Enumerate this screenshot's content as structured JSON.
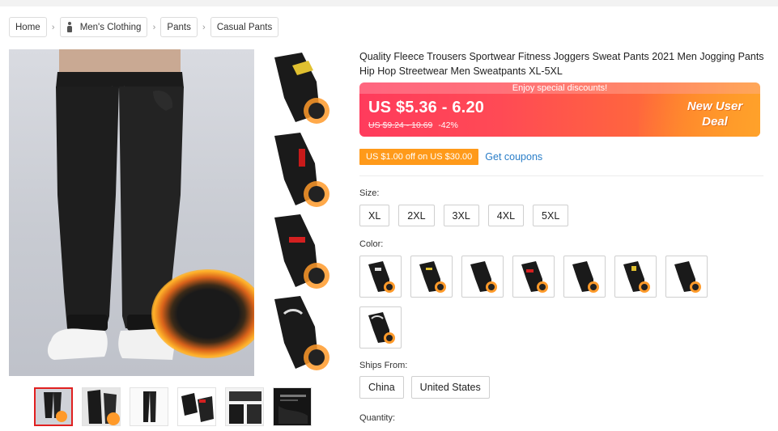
{
  "breadcrumb": {
    "items": [
      {
        "label": "Home"
      },
      {
        "label": "Men's Clothing",
        "icon": "person-icon"
      },
      {
        "label": "Pants"
      },
      {
        "label": "Casual Pants"
      }
    ],
    "separator": "›"
  },
  "product": {
    "title": "Quality Fleece Trousers Sportwear Fitness Joggers Sweat Pants 2021 Men Jogging Pants Hip Hop Streetwear Men Sweatpants XL-5XL"
  },
  "price": {
    "strip_text": "Enjoy special discounts!",
    "current": "US $5.36 - 6.20",
    "original": "US $9.24 - 10.69",
    "discount": "-42%",
    "badge_line1": "New User",
    "badge_line2": "Deal",
    "colors": {
      "start": "#ff3b5c",
      "end": "#ff8f2a"
    }
  },
  "coupon": {
    "badge": "US $1.00 off on US $30.00",
    "link": "Get coupons",
    "badge_color": "#ff9a1a",
    "link_color": "#2a7ec8"
  },
  "size": {
    "label": "Size:",
    "options": [
      "XL",
      "2XL",
      "3XL",
      "4XL",
      "5XL"
    ]
  },
  "color": {
    "label": "Color:",
    "swatch_count": 8
  },
  "ships_from": {
    "label": "Ships From:",
    "options": [
      "China",
      "United States"
    ]
  },
  "quantity": {
    "label": "Quantity:"
  }
}
